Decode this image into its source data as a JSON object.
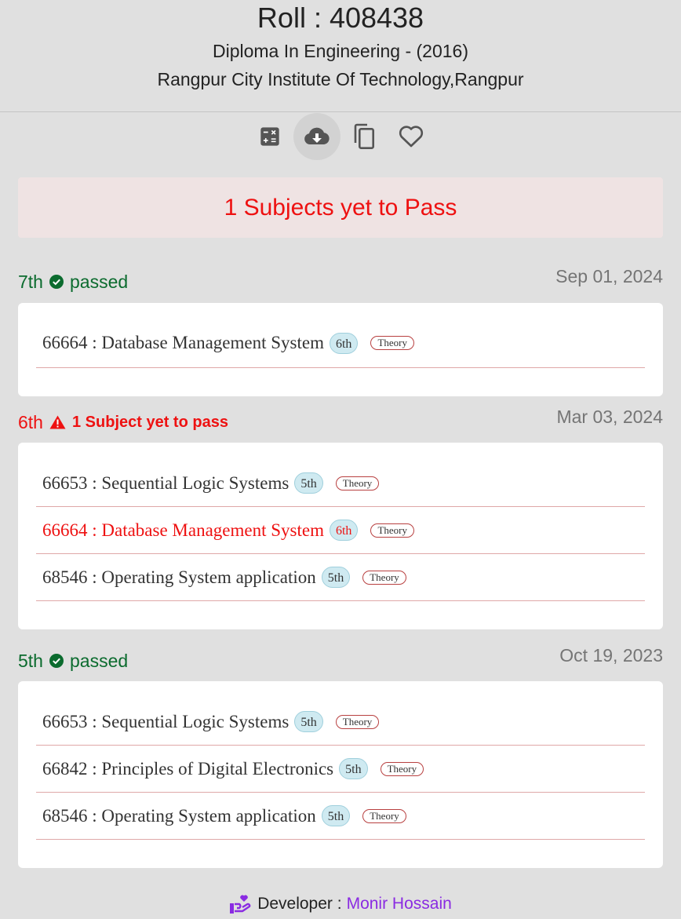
{
  "header": {
    "roll": "Roll : 408438",
    "program": "Diploma In Engineering - (2016)",
    "institute": "Rangpur City Institute Of Technology,Rangpur"
  },
  "toolbar": {
    "icons": [
      "calculator-icon",
      "cloud-download-icon",
      "copy-icon",
      "heart-icon"
    ]
  },
  "alert": {
    "text": "1 Subjects yet to Pass"
  },
  "semesters": [
    {
      "semester": "7th",
      "status": "passed",
      "date": "Sep 01, 2024",
      "subjects": [
        {
          "label": "66664 : Database Management System",
          "sem": "6th",
          "type": "Theory",
          "failed": false
        }
      ]
    },
    {
      "semester": "6th",
      "status": "1 Subject yet to pass",
      "date": "Mar 03, 2024",
      "subjects": [
        {
          "label": "66653 : Sequential Logic Systems",
          "sem": "5th",
          "type": "Theory",
          "failed": false
        },
        {
          "label": "66664 : Database Management System",
          "sem": "6th",
          "type": "Theory",
          "failed": true
        },
        {
          "label": "68546 : Operating System application",
          "sem": "5th",
          "type": "Theory",
          "failed": false
        }
      ]
    },
    {
      "semester": "5th",
      "status": "passed",
      "date": "Oct 19, 2023",
      "subjects": [
        {
          "label": "66653 : Sequential Logic Systems",
          "sem": "5th",
          "type": "Theory",
          "failed": false
        },
        {
          "label": "66842 : Principles of Digital Electronics",
          "sem": "5th",
          "type": "Theory",
          "failed": false
        },
        {
          "label": "68546 : Operating System application",
          "sem": "5th",
          "type": "Theory",
          "failed": false
        }
      ]
    }
  ],
  "footer": {
    "label": "Developer :",
    "name": "Monir Hossain"
  },
  "colors": {
    "pass": "#0b6b2e",
    "fail": "#ee1111",
    "developer": "#8a2be2"
  }
}
